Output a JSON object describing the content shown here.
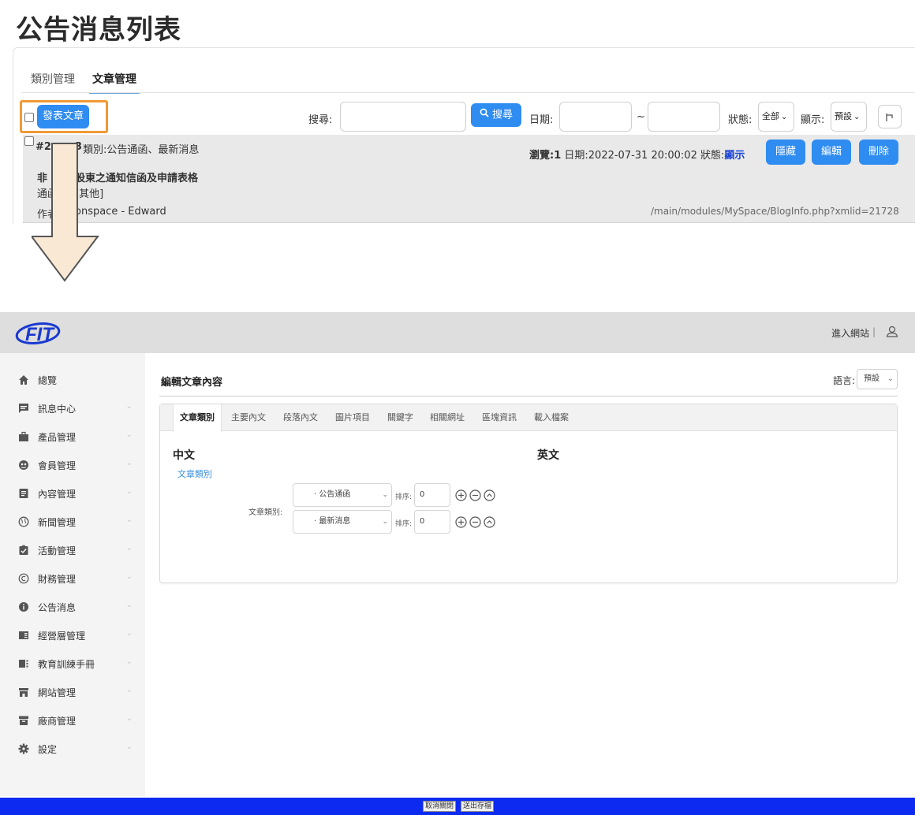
{
  "list_page": {
    "title": "公告消息列表",
    "tabs": [
      {
        "label": "類別管理"
      },
      {
        "label": "文章管理"
      }
    ],
    "toolbar": {
      "publish_label": "發表文章",
      "search_label": "搜尋:",
      "search_button": "搜尋",
      "date_label": "日期:",
      "date_separator": "~",
      "status_label": "狀態:",
      "status_value": "全部",
      "display_label": "顯示:",
      "display_value": "預設"
    },
    "row": {
      "id_prefix": "#2",
      "id_suffix": "3",
      "category": "類別:公告通函、最新消息",
      "stats_views": "瀏覽:1",
      "stats_date": "日期:2022-07-31 20:00:02",
      "stats_status_label": "狀態:",
      "status_value": "顯示",
      "title_a": "非",
      "title_b": "股東之通知信函及申請表格",
      "tag_a": "通函",
      "tag_b": "[其他]",
      "author_a": "作者",
      "author_b": "onspace - Edward",
      "path": "/main/modules/MySpace/BlogInfo.php?xmlid=21728",
      "btn_hide": "隱藏",
      "btn_edit": "編輯",
      "btn_delete": "刪除"
    }
  },
  "admin": {
    "logo_text": "FIT",
    "enter_site": "進入網站",
    "sidebar": [
      {
        "label": "總覽",
        "icon": "home-icon"
      },
      {
        "label": "訊息中心",
        "icon": "message-icon"
      },
      {
        "label": "產品管理",
        "icon": "briefcase-icon"
      },
      {
        "label": "會員管理",
        "icon": "member-icon"
      },
      {
        "label": "內容管理",
        "icon": "document-icon"
      },
      {
        "label": "新聞管理",
        "icon": "globe-icon"
      },
      {
        "label": "活動管理",
        "icon": "clipboard-icon"
      },
      {
        "label": "財務管理",
        "icon": "copyright-icon"
      },
      {
        "label": "公告消息",
        "icon": "info-icon"
      },
      {
        "label": "經營層管理",
        "icon": "panel-icon"
      },
      {
        "label": "教育訓練手冊",
        "icon": "manual-icon"
      },
      {
        "label": "網站管理",
        "icon": "store-icon"
      },
      {
        "label": "廠商管理",
        "icon": "archive-icon"
      },
      {
        "label": "設定",
        "icon": "gear-icon"
      }
    ],
    "content_title": "編輯文章內容",
    "language_label": "語言:",
    "language_value": "預設",
    "editor_tabs": [
      {
        "label": "文章類別"
      },
      {
        "label": "主要內文"
      },
      {
        "label": "段落內文"
      },
      {
        "label": "圖片項目"
      },
      {
        "label": "關鍵字"
      },
      {
        "label": "相關網址"
      },
      {
        "label": "區塊資訊"
      },
      {
        "label": "載入檔案"
      }
    ],
    "section_zh": "中文",
    "section_en": "英文",
    "category_link": "文章類別",
    "category_field_label": "文章類別:",
    "categories": [
      {
        "value": "· 公告通函",
        "sort_label": "排序:",
        "sort_value": "0"
      },
      {
        "value": "· 最新消息",
        "sort_label": "排序:",
        "sort_value": "0"
      }
    ],
    "footer": {
      "cancel": "取消關閉",
      "save": "送出存檔"
    }
  }
}
